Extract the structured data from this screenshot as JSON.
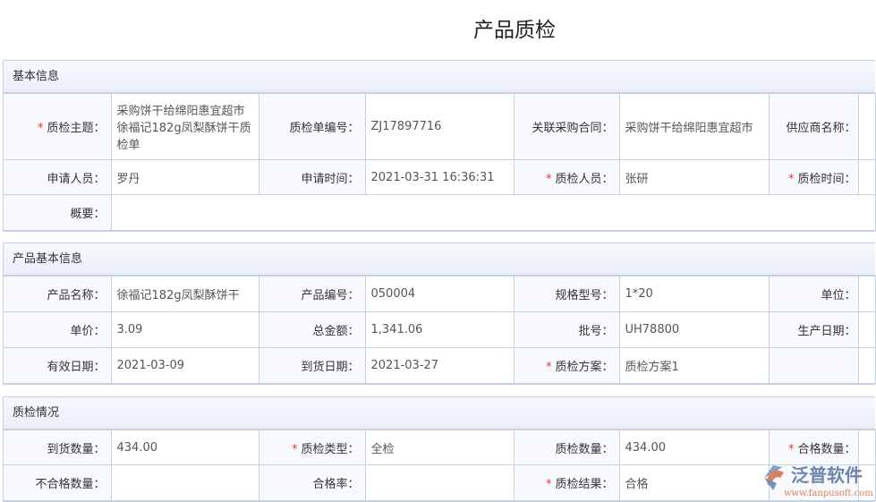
{
  "title": "产品质检",
  "sections": [
    {
      "header": "基本信息",
      "rows": [
        [
          {
            "l": "质检主题：",
            "req": true,
            "v": "采购饼干给绵阳惠宜超市徐福记182g凤梨酥饼干质检单"
          },
          {
            "l": "质检单编号：",
            "v": "ZJ17897716"
          },
          {
            "l": "关联采购合同：",
            "v": "采购饼干给绵阳惠宜超市"
          },
          {
            "l": "供应商名称：",
            "v": ""
          }
        ],
        [
          {
            "l": "申请人员：",
            "v": "罗丹"
          },
          {
            "l": "申请时间：",
            "v": "2021-03-31 16:36:31"
          },
          {
            "l": "质检人员：",
            "req": true,
            "v": "张研"
          },
          {
            "l": "质检时间：",
            "req": true,
            "v": ""
          }
        ],
        [
          {
            "l": "概要：",
            "v": "",
            "span": 7
          }
        ]
      ]
    },
    {
      "header": "产品基本信息",
      "rows": [
        [
          {
            "l": "产品名称：",
            "v": "徐福记182g凤梨酥饼干"
          },
          {
            "l": "产品编号：",
            "v": "050004"
          },
          {
            "l": "规格型号：",
            "v": "1*20"
          },
          {
            "l": "单位：",
            "v": ""
          }
        ],
        [
          {
            "l": "单价：",
            "v": "3.09"
          },
          {
            "l": "总金额：",
            "v": "1,341.06"
          },
          {
            "l": "批号：",
            "v": "UH78800"
          },
          {
            "l": "生产日期：",
            "v": ""
          }
        ],
        [
          {
            "l": "有效日期：",
            "v": "2021-03-09"
          },
          {
            "l": "到货日期：",
            "v": "2021-03-27"
          },
          {
            "l": "质检方案：",
            "req": true,
            "v": "质检方案1"
          },
          {
            "l": "",
            "v": ""
          }
        ]
      ]
    },
    {
      "header": "质检情况",
      "rows": [
        [
          {
            "l": "到货数量：",
            "v": "434.00"
          },
          {
            "l": "质检类型：",
            "req": true,
            "v": "全检"
          },
          {
            "l": "质检数量：",
            "v": "434.00"
          },
          {
            "l": "合格数量：",
            "req": true,
            "v": ""
          }
        ],
        [
          {
            "l": "不合格数量：",
            "v": ""
          },
          {
            "l": "合格率：",
            "v": ""
          },
          {
            "l": "质检结果：",
            "req": true,
            "v": "合格"
          },
          {
            "l": "",
            "v": ""
          }
        ]
      ]
    }
  ],
  "watermark": {
    "brand": "泛普软件",
    "url": "www.fanpusoft.com"
  }
}
